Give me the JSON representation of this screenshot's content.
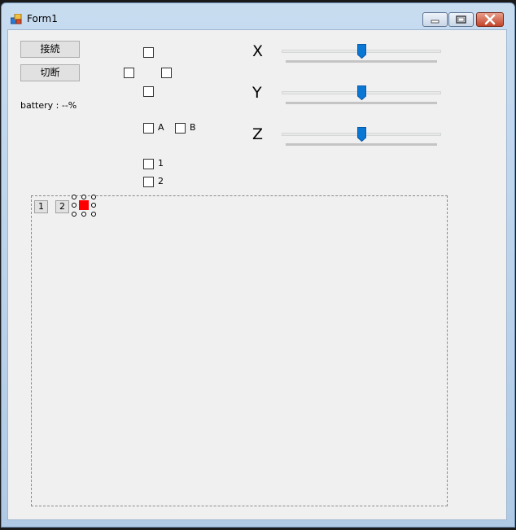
{
  "window": {
    "title": "Form1"
  },
  "buttons": {
    "connect": "接続",
    "disconnect": "切断"
  },
  "battery": "battery : --%",
  "checkboxes": {
    "a_label": "A",
    "b_label": "B",
    "one_label": "1",
    "two_label": "2"
  },
  "sliders": [
    {
      "axis": "X",
      "value": 0.5
    },
    {
      "axis": "Y",
      "value": 0.5
    },
    {
      "axis": "Z",
      "value": 0.5
    }
  ],
  "tabs": [
    "1",
    "2"
  ],
  "colors": {
    "slider_thumb": "#0a77d4",
    "selected_box": "#ff0000"
  }
}
